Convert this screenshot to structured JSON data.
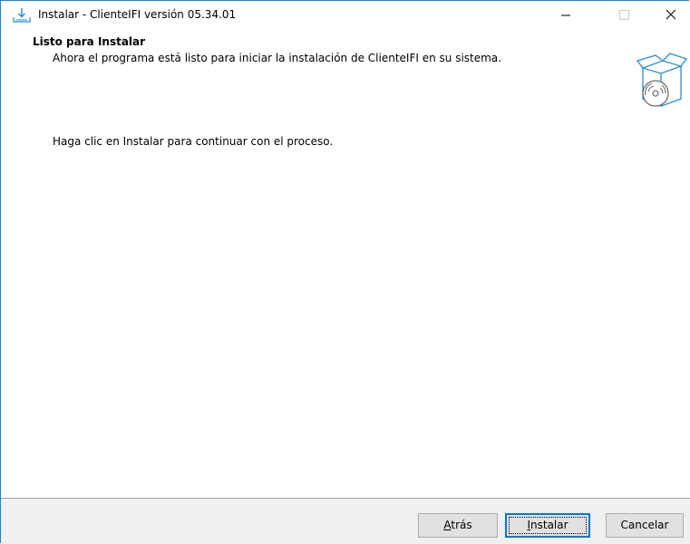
{
  "window": {
    "title": "Instalar - ClienteIFI versión 05.34.01",
    "icon": "install-download-icon",
    "controls": {
      "minimize_icon": "minimize-icon",
      "maximize_icon": "maximize-icon",
      "close_icon": "close-icon"
    }
  },
  "header": {
    "title": "Listo para Instalar",
    "subtitle": "Ahora el programa está listo para iniciar la instalación de ClienteIFI en su sistema.",
    "graphic": "box-with-disc-icon"
  },
  "main": {
    "instruction": "Haga clic en Instalar para continuar con el proceso."
  },
  "footer": {
    "back_accel": "A",
    "back_rest": "trás",
    "install_accel": "I",
    "install_rest": "nstalar",
    "cancel_label": "Cancelar"
  },
  "colors": {
    "window_border": "#1883d7",
    "footer_bg": "#f0f0f0",
    "default_button_border": "#0078d7",
    "graphic_stroke": "#2a8fd0"
  }
}
